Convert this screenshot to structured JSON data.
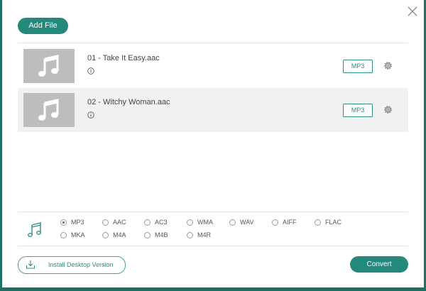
{
  "toolbar": {
    "add_file_label": "Add File"
  },
  "files": [
    {
      "name": "01 - Take It Easy.aac",
      "format": "MP3"
    },
    {
      "name": "02 - Witchy Woman.aac",
      "format": "MP3"
    }
  ],
  "formats": {
    "options": [
      "MP3",
      "AAC",
      "AC3",
      "WMA",
      "WAV",
      "AIFF",
      "FLAC",
      "MKA",
      "M4A",
      "M4B",
      "M4R"
    ],
    "selected": "MP3"
  },
  "footer": {
    "install_label": "Install Desktop Version",
    "convert_label": "Convert"
  },
  "colors": {
    "accent": "#23897b",
    "background": "#1f6f67"
  },
  "icons": [
    "close-icon",
    "music-note-icon",
    "info-icon",
    "gear-icon",
    "download-icon"
  ]
}
